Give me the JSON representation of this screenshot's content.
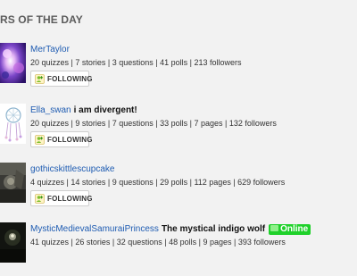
{
  "section": {
    "title": "RS OF THE DAY"
  },
  "users": [
    {
      "username": "MerTaylor",
      "tagline": "",
      "online": "",
      "stats": "20 quizzes | 7 stories | 3 questions | 41 polls | 213 followers",
      "follow_label": "FOLLOWING"
    },
    {
      "username": "Ella_swan",
      "tagline": "i am divergent!",
      "online": "",
      "stats": "20 quizzes | 9 stories | 7 questions | 33 polls | 7 pages | 132 followers",
      "follow_label": "FOLLOWING"
    },
    {
      "username": "gothicskittlescupcake",
      "tagline": "",
      "online": "",
      "stats": "4 quizzes | 14 stories | 9 questions | 29 polls | 112 pages | 629 followers",
      "follow_label": "FOLLOWING"
    },
    {
      "username": "MysticMedievalSamuraiPrincess",
      "tagline": "The mystical indigo wolf",
      "online": "Online",
      "stats": "41 quizzes | 26 stories | 32 questions | 48 polls | 9 pages | 393 followers",
      "follow_label": ""
    }
  ],
  "colors": {
    "link": "#1f5cb2",
    "online_badge": "#1fd12a",
    "background": "#f2f2f2"
  },
  "icons": {
    "follow": "add-user-icon"
  }
}
